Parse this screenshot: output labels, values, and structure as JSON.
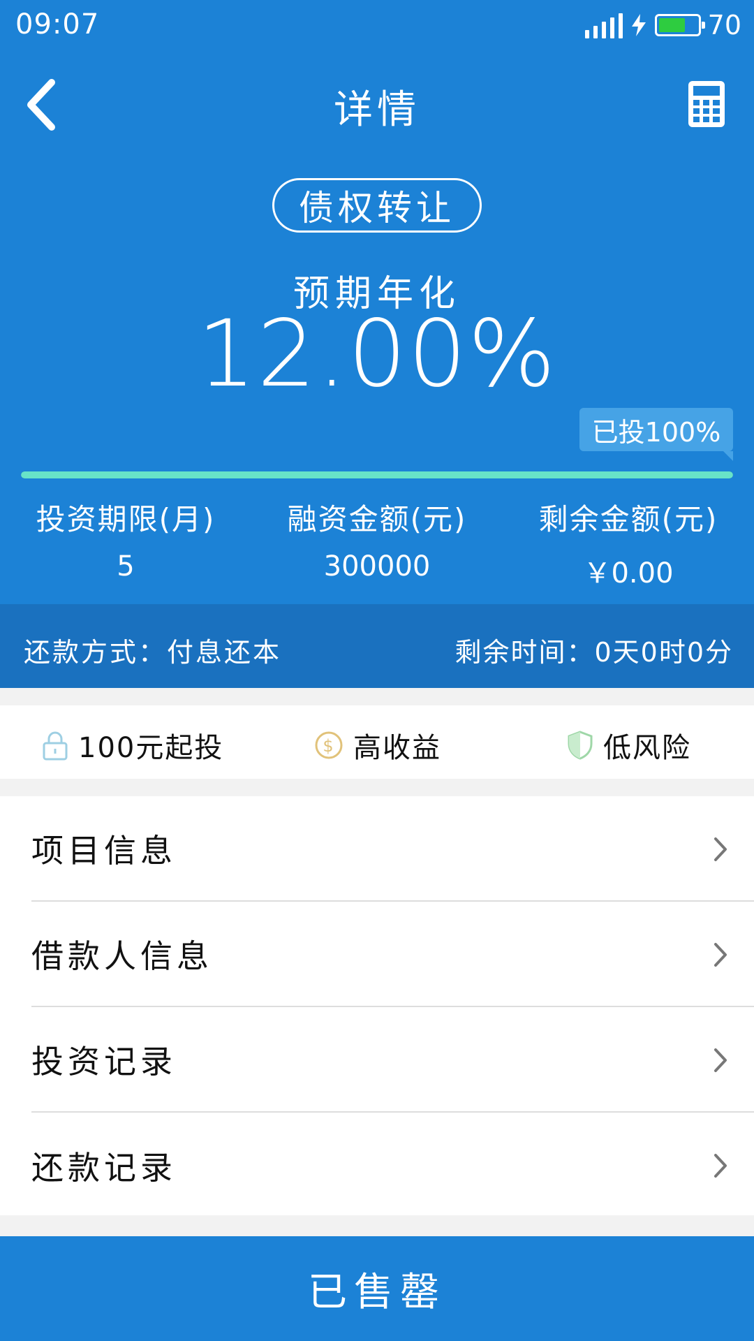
{
  "status_bar": {
    "time": "09:07",
    "battery_level": "70",
    "battery_fraction": 0.7
  },
  "header": {
    "title": "详情",
    "back_icon": "chevron-left-icon",
    "calculator_icon": "calculator-icon"
  },
  "product": {
    "type_tag": "债权转让",
    "rate_label": "预期年化",
    "rate_value": "12.00%",
    "progress_text": "已投100%",
    "progress_fraction": 1.0
  },
  "stats": [
    {
      "label": "投资期限(月)",
      "value": "5"
    },
    {
      "label": "融资金额(元)",
      "value": "300000"
    },
    {
      "label": "剩余金额(元)",
      "value": "￥0.00"
    }
  ],
  "repayment": {
    "method": "还款方式：付息还本",
    "time_left": "剩余时间：0天0时0分"
  },
  "features": [
    {
      "icon": "lock-icon",
      "label": "100元起投"
    },
    {
      "icon": "dollar-coin-icon",
      "label": "高收益"
    },
    {
      "icon": "shield-icon",
      "label": "低风险"
    }
  ],
  "menu": [
    {
      "label": "项目信息"
    },
    {
      "label": "借款人信息"
    },
    {
      "label": "投资记录"
    },
    {
      "label": "还款记录"
    }
  ],
  "bottom_button": {
    "label": "已售罄"
  },
  "colors": {
    "primary_blue": "#1c82d6",
    "dark_blue_bar": "#1a71bf",
    "progress_fill": "#68e3c8"
  }
}
